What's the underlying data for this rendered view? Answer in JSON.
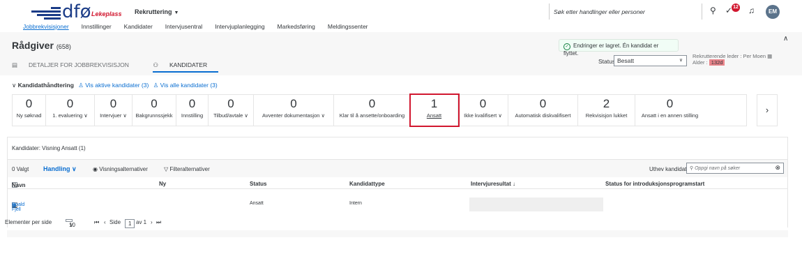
{
  "header": {
    "brand": "dfø",
    "brand_tag": "Lekeplass",
    "module": "Rekruttering",
    "search_placeholder": "Søk etter handlinger eller personer",
    "notif_count": "12",
    "avatar": "EM",
    "nav": [
      "Jobbrekvisisjoner",
      "Innstillinger",
      "Kandidater",
      "Intervjusentral",
      "Intervjuplanlegging",
      "Markedsføring",
      "Meldingssenter"
    ]
  },
  "object": {
    "title": "Rådgiver",
    "count": "(658)",
    "tabs": [
      "DETALJER FOR JOBBREKVISISJON",
      "KANDIDATER"
    ],
    "toast": "Endringer er lagret. Én kandidat er flyttet.",
    "status_label": "Status",
    "status_value": "Besatt",
    "leder": "Rekrutterende leder : Per Moen",
    "alder_label": "Alder :",
    "alder_value": "132d"
  },
  "kh": {
    "title": "Kandidathåndtering",
    "link_active": "Vis aktive kandidater (3)",
    "link_all": "Vis alle kandidater (3)"
  },
  "steps": [
    {
      "num": "0",
      "label": "Ny søknad"
    },
    {
      "num": "0",
      "label": "1. evaluering ∨"
    },
    {
      "num": "0",
      "label": "Intervjuer ∨"
    },
    {
      "num": "0",
      "label": "Bakgrunnssjekk"
    },
    {
      "num": "0",
      "label": "Innstilling"
    },
    {
      "num": "0",
      "label": "Tilbud/avtale ∨"
    },
    {
      "num": "0",
      "label": "Avventer dokumentasjon ∨"
    },
    {
      "num": "0",
      "label": "Klar til å ansette/onboarding"
    },
    {
      "num": "1",
      "label": "Ansatt"
    },
    {
      "num": "0",
      "label": "Ikke kvalifisert ∨"
    },
    {
      "num": "0",
      "label": "Automatisk diskvalifisert"
    },
    {
      "num": "2",
      "label": "Rekvisisjon lukket"
    },
    {
      "num": "0",
      "label": "Ansatt i en annen stilling"
    }
  ],
  "table": {
    "view": "Kandidater: Visning Ansatt (1)",
    "valgt": "0 Valgt",
    "handling": "Handling ∨",
    "vis_alt": "Visningsalternativer",
    "filter_alt": "Filteralternativer",
    "uthev": "Uthev kandidat",
    "uthev_placeholder": "Oppgi navn på søker",
    "columns": [
      "Navn",
      "Ny",
      "Status",
      "Kandidattype",
      "Intervjuresultat ↓",
      "Status for introduksjonsprogramstart"
    ],
    "row": {
      "name": "Roald Fjell",
      "status": "Ansatt",
      "type": "Intern"
    },
    "per_page_label": "Elementer per side",
    "per_page": "10",
    "side_label": "Side",
    "page": "1",
    "of": "av 1"
  }
}
